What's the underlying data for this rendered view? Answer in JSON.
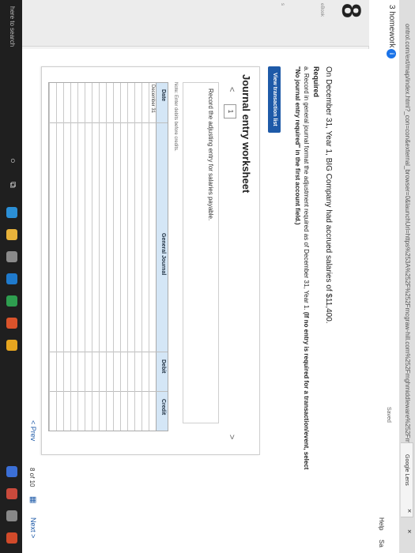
{
  "browser": {
    "url": "ontrol.com/ext/map/index.html?_con=con&external_browser=0&launchUrl=https%253A%252F%252Fmcgraw-hill.com%252Fmghmiddleware%252Fmheproduct%252",
    "tab_label": "Google Lens",
    "close_glyph": "×"
  },
  "header": {
    "homework": "3 homework",
    "info_glyph": "i",
    "saved": "Saved",
    "help": "Help",
    "save_exit": "Sa"
  },
  "question": {
    "number": "8",
    "rail_label_1": "eBook",
    "rail_label_2": "s",
    "text": "On December 31, Year 1, BIG Company had accrued salaries of $11,400.",
    "required": "Required",
    "instr_a": "a. Record in general journal format the adjustment required as of December 31, Year 1.",
    "instr_b": "(If no entry is required for a transaction/event, select \"No journal entry required\" in the first account field.)"
  },
  "view_button": "View transaction list",
  "worksheet": {
    "title": "Journal entry worksheet",
    "prev_glyph": "<",
    "entry_num": "1",
    "next_glyph": ">",
    "entry_text": "Record the adjusting entry for salaries payable.",
    "note": "Note: Enter debits before credits.",
    "columns": [
      "Date",
      "General Journal",
      "Debit",
      "Credit"
    ],
    "row_date": "December 31"
  },
  "pager": {
    "prev": "< Prev",
    "indicator": "8 of 10",
    "grid_glyph": "▦",
    "next": "Next >"
  },
  "taskbar": {
    "search": "here to search",
    "cortana_glyph": "○",
    "taskview_glyph": "⧉"
  }
}
